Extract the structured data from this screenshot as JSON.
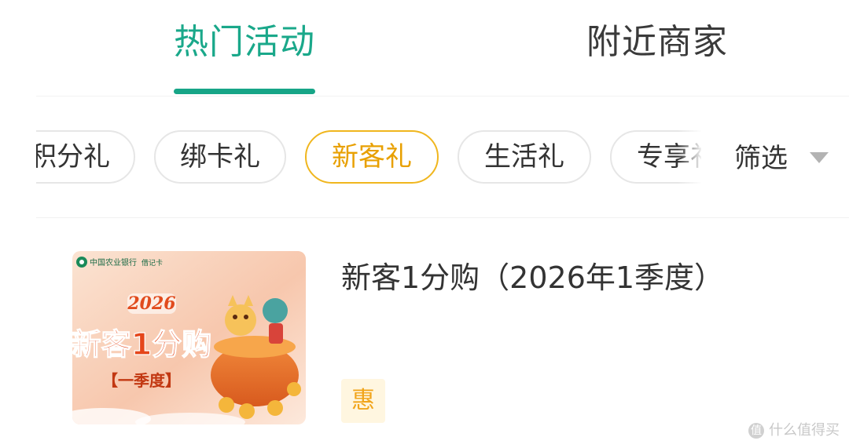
{
  "tabs": [
    {
      "label": "热门活动",
      "active": true
    },
    {
      "label": "附近商家",
      "active": false
    }
  ],
  "chips": [
    {
      "label": "积分礼",
      "selected": false
    },
    {
      "label": "绑卡礼",
      "selected": false
    },
    {
      "label": "新客礼",
      "selected": true
    },
    {
      "label": "生活礼",
      "selected": false
    },
    {
      "label": "专享礼",
      "selected": false
    }
  ],
  "filter": {
    "label": "筛选",
    "icon": "triangle-down-icon"
  },
  "card": {
    "title": "新客1分购（2026年1季度）",
    "badge": "惠",
    "banner": {
      "bank_name": "中国农业银行",
      "tag": "借记卡",
      "year": "2026",
      "headline": "新客1分购",
      "period": "【一季度】"
    }
  },
  "watermark": {
    "icon": "值",
    "text": "什么值得买"
  },
  "colors": {
    "active_tab": "#1aa88a",
    "underline": "#17a587",
    "selected_chip_border": "#f0b61e",
    "selected_chip_text": "#e8a000",
    "badge_bg": "#fff6e0",
    "badge_text": "#f1a51c"
  }
}
